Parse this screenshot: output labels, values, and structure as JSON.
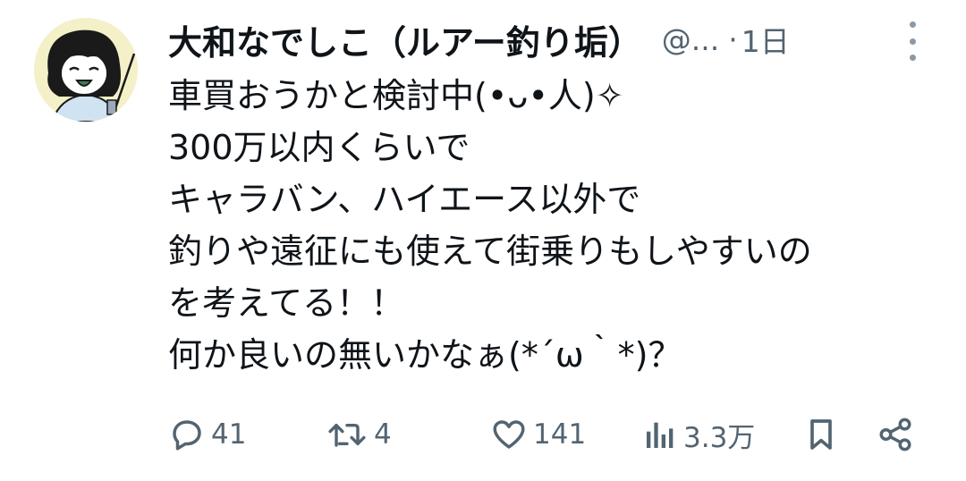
{
  "tweet": {
    "author_name": "大和なでしこ（ルアー釣り垢）",
    "handle": "@...",
    "dot": "·",
    "time": "1日",
    "lines": [
      "車買おうかと検討中(•ᴗ•人)✧",
      "300万以内くらいで",
      "キャラバン、ハイエース以外で",
      "釣りや遠征にも使えて街乗りもしやすいの",
      "を考えてる！！",
      "何か良いの無いかなぁ(*´ω｀*)？"
    ]
  },
  "actions": {
    "replies": "41",
    "retweets": "4",
    "likes": "141",
    "views": "3.3万"
  },
  "icons": {
    "reply": "reply-icon",
    "retweet": "retweet-icon",
    "like": "heart-icon",
    "views": "views-icon",
    "bookmark": "bookmark-icon",
    "share": "share-icon",
    "more": "more-vertical-icon"
  },
  "colors": {
    "text": "#0f1419",
    "secondary": "#536471",
    "avatar_bg": "#f4f0c8"
  }
}
